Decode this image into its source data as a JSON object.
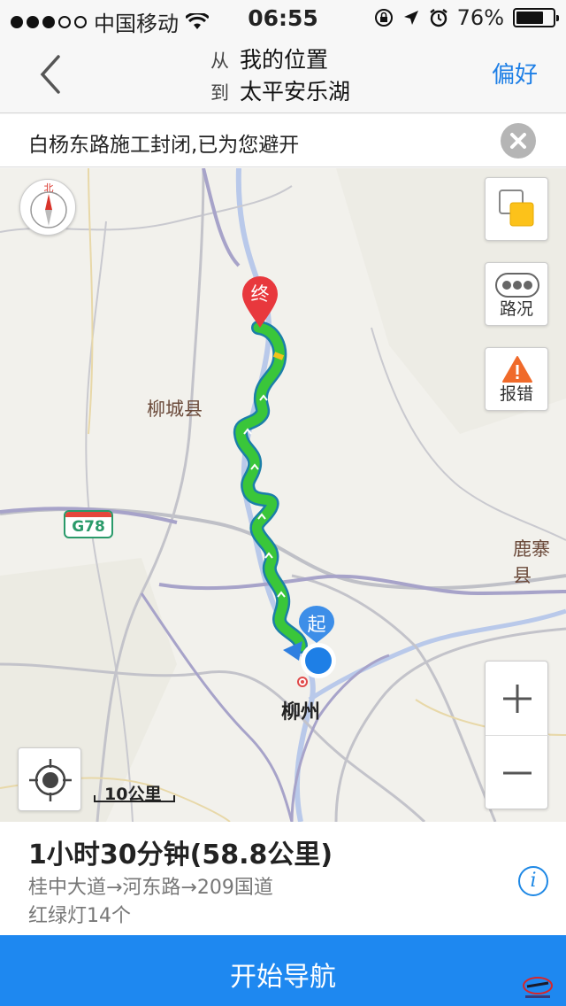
{
  "status": {
    "carrier": "中国移动",
    "time": "06:55",
    "battery": "76%",
    "battery_level": 0.76
  },
  "nav": {
    "from_tag": "从",
    "from": "我的位置",
    "to_tag": "到",
    "to": "太平安乐湖",
    "pref_label": "偏好"
  },
  "notice": {
    "text": "白杨东路施工封闭,已为您避开"
  },
  "map": {
    "compass_label": "北",
    "labels": {
      "county1": "柳城县",
      "county2": "鹿寨县",
      "city": "柳州",
      "highway": "G78"
    },
    "buttons": {
      "traffic": "路况",
      "report": "报错"
    },
    "end_marker": "终",
    "start_marker": "起",
    "scale": "10公里",
    "colors": {
      "route": "#3ac63a",
      "route_outline": "#1b7fa8",
      "end_pin": "#e8383d",
      "start_pin": "#3d8ee8",
      "accent": "#1e88f0"
    }
  },
  "route_info": {
    "duration": "1小时30分钟",
    "distance": "(58.8公里)",
    "roads": "桂中大道→河东路→209国道",
    "lights": "红绿灯14个"
  },
  "start_nav_label": "开始导航"
}
